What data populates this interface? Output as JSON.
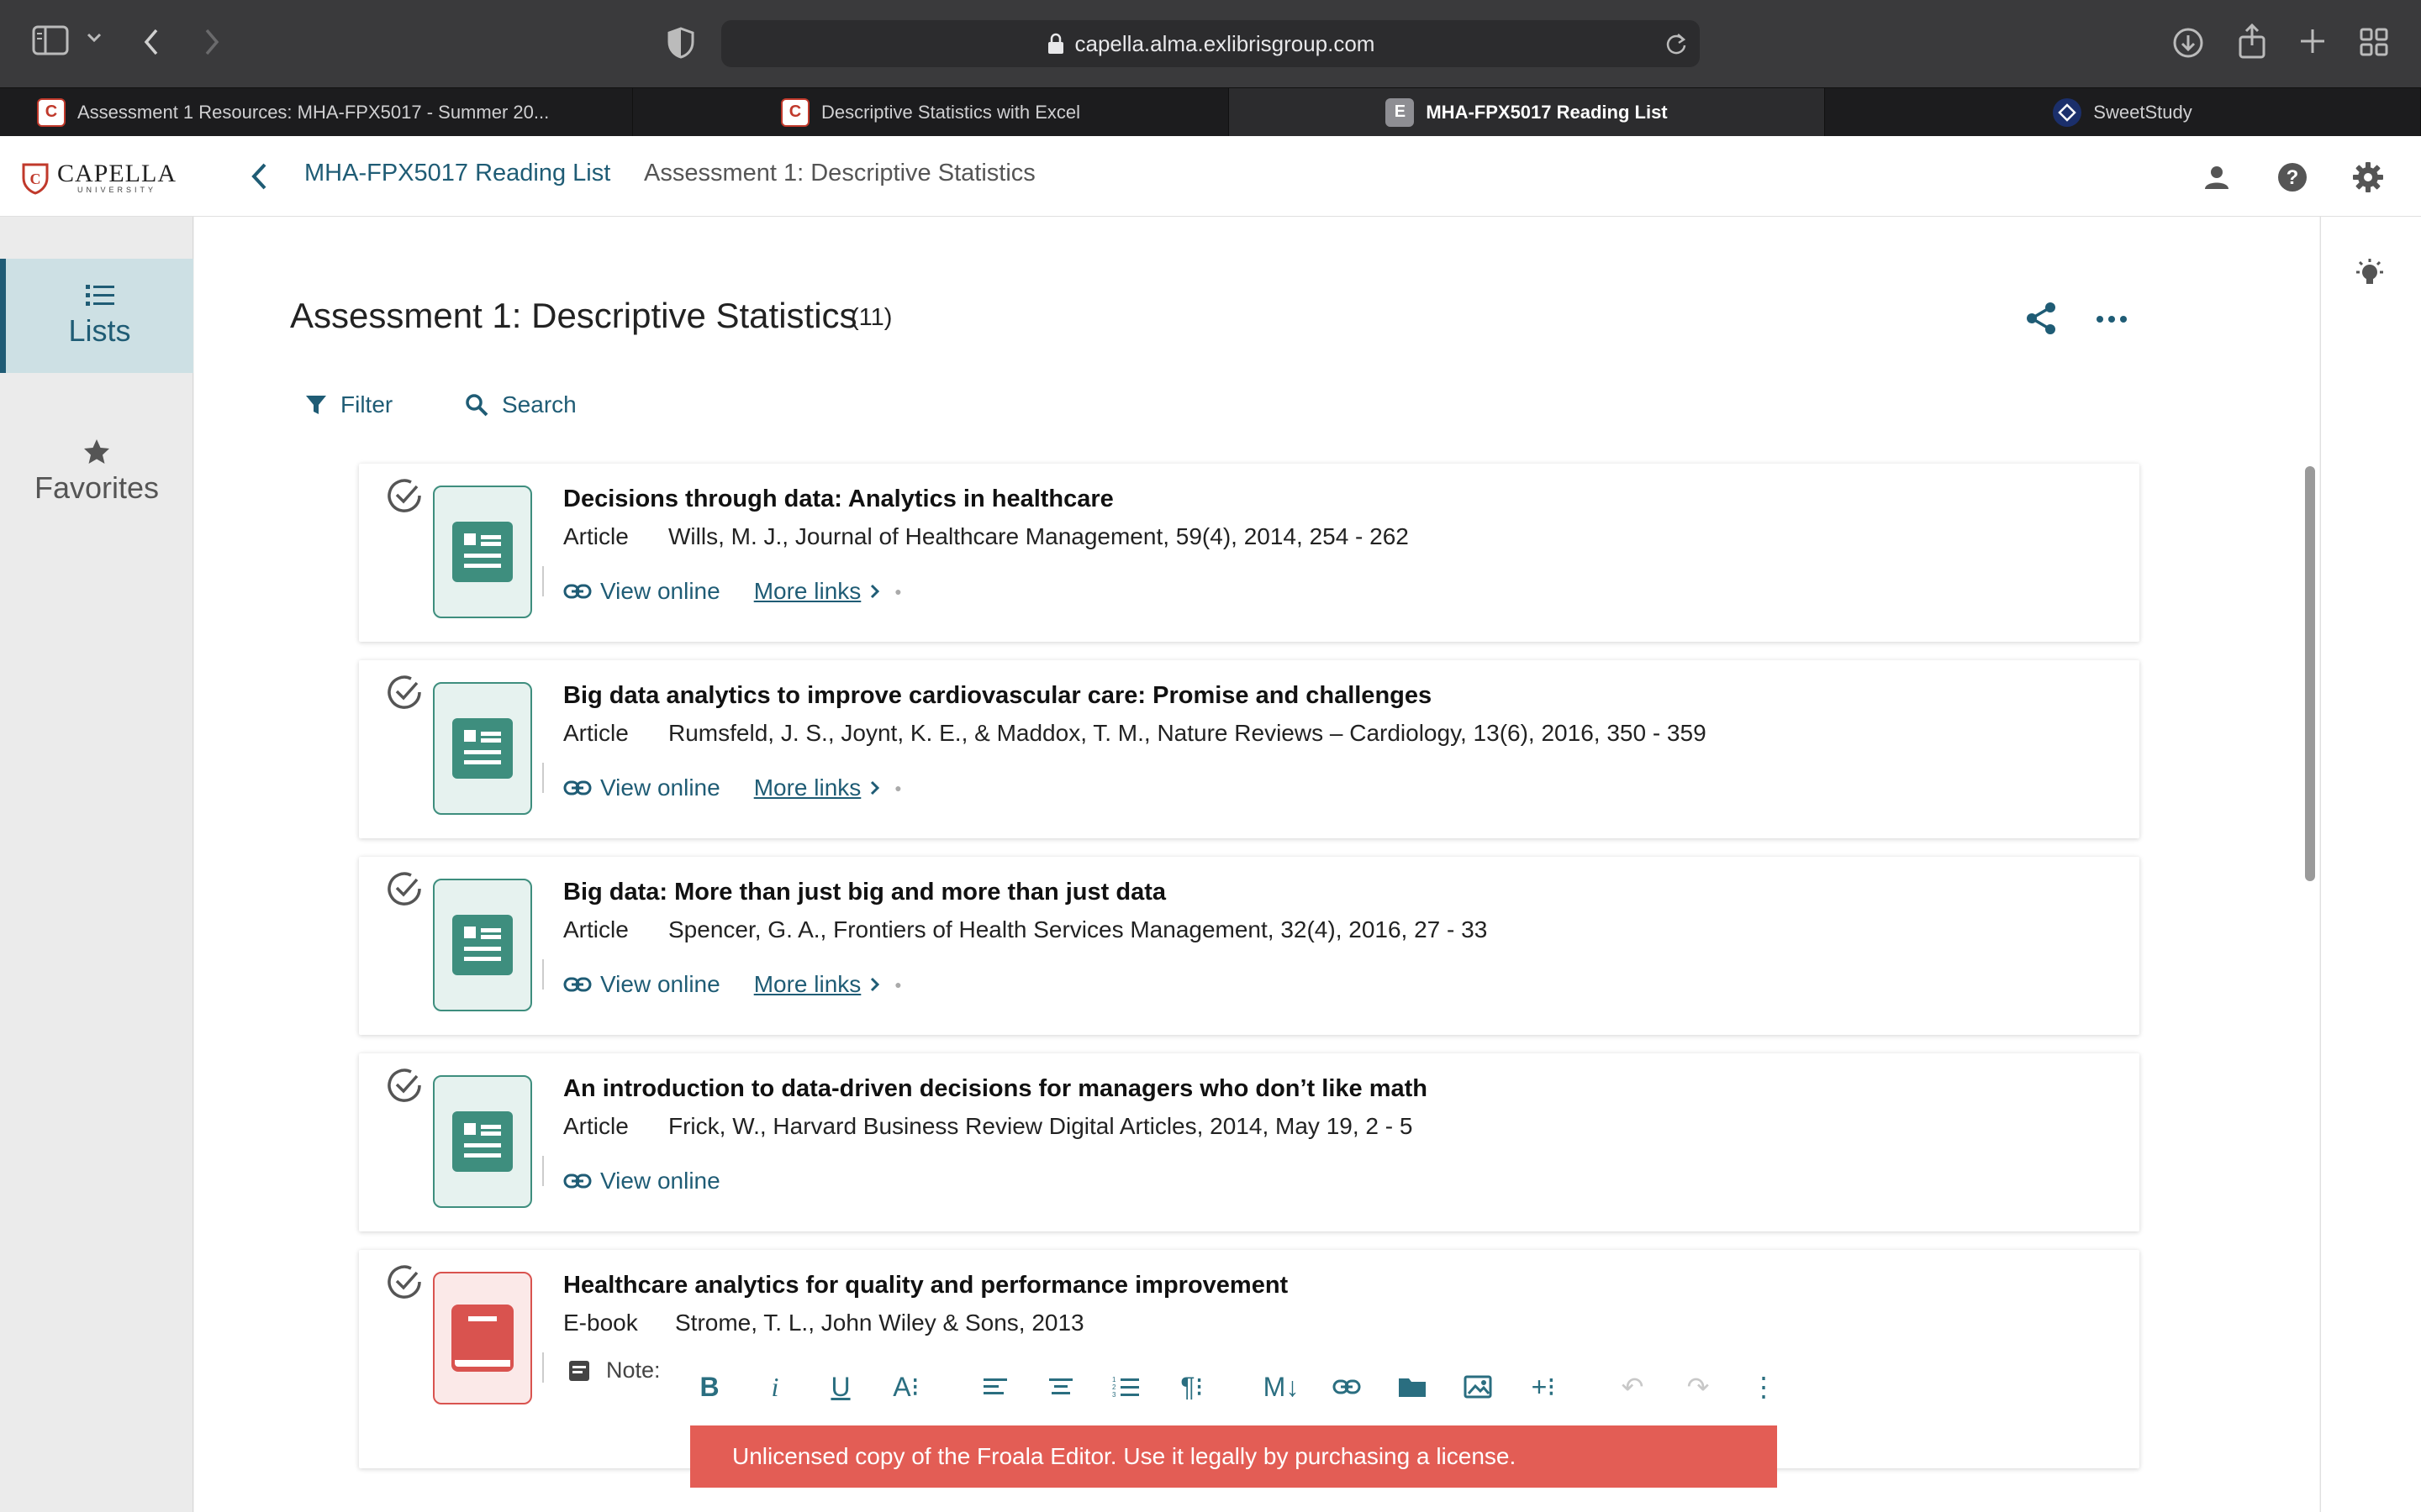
{
  "browser": {
    "url": "capella.alma.exlibrisgroup.com",
    "tabs": [
      {
        "label": "Assessment 1 Resources: MHA-FPX5017 - Summer 20...",
        "favicon": "capella-icon",
        "active": false
      },
      {
        "label": "Descriptive Statistics with Excel",
        "favicon": "capella-icon",
        "active": false
      },
      {
        "label": "MHA-FPX5017 Reading List",
        "favicon": "E",
        "active": true
      },
      {
        "label": "SweetStudy",
        "favicon": "sweetstudy-icon",
        "active": false
      }
    ]
  },
  "logo": {
    "name": "CAPELLA",
    "sub": "UNIVERSITY"
  },
  "header": {
    "breadcrumb_list": "MHA-FPX5017 Reading List",
    "breadcrumb_current": "Assessment 1: Descriptive Statistics"
  },
  "sidebar": {
    "items": [
      {
        "label": "Lists",
        "icon": "list-icon",
        "active": true
      },
      {
        "label": "Favorites",
        "icon": "star-icon",
        "active": false
      }
    ]
  },
  "main": {
    "title": "Assessment 1: Descriptive Statistics",
    "count": "(11)",
    "filter_label": "Filter",
    "search_label": "Search",
    "view_online_label": "View online",
    "more_links_label": "More links",
    "items": [
      {
        "title": "Decisions through data: Analytics in healthcare",
        "type": "Article",
        "citation": "Wills, M. J., Journal of Healthcare Management, 59(4), 2014, 254 - 262"
      },
      {
        "title": "Big data analytics to improve cardiovascular care: Promise and challenges",
        "type": "Article",
        "citation": "Rumsfeld, J. S., Joynt, K. E., & Maddox, T. M., Nature Reviews – Cardiology, 13(6), 2016, 350 - 359"
      },
      {
        "title": "Big data: More than just big and more than just data",
        "type": "Article",
        "citation": "Spencer, G. A., Frontiers of Health Services Management, 32(4), 2016, 27 - 33"
      },
      {
        "title": "An introduction to data-driven decisions for managers who don’t like math",
        "type": "Article",
        "citation": "Frick, W., Harvard Business Review Digital Articles, 2014, May 19, 2 - 5"
      },
      {
        "title": "Healthcare analytics for quality and performance improvement",
        "type": "E-book",
        "citation": "Strome, T. L., John Wiley & Sons, 2013"
      }
    ],
    "note_label": "Note:",
    "froala_banner": "Unlicensed copy of the Froala Editor. Use it legally by purchasing a license."
  },
  "colors": {
    "accent": "#1f5c75",
    "article_icon": "#3e8e7e",
    "ebook_icon": "#d9534f",
    "banner": "#e35d55"
  }
}
